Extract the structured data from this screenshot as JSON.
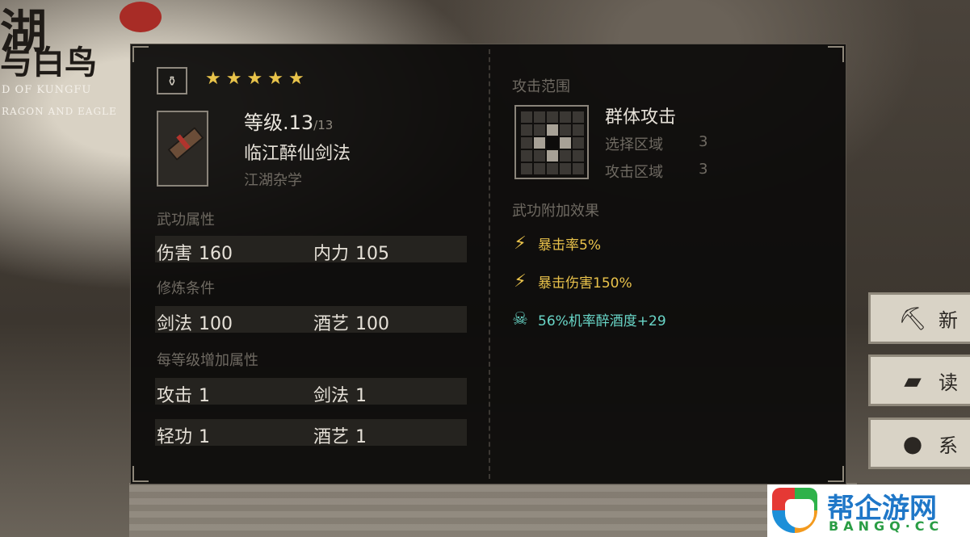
{
  "logo": {
    "title_big": "湖",
    "title_sub": "与白鸟",
    "subtitle_en_1": "D OF KUNGFU",
    "subtitle_en_2": "RAGON AND EAGLE"
  },
  "skill": {
    "rarity_stars": 5,
    "level_label": "等级.13",
    "level_max": "/13",
    "name": "临江醉仙剑法",
    "category": "江湖杂学"
  },
  "sections": {
    "attributes_title": "武功属性",
    "requirements_title": "修炼条件",
    "per_level_title": "每等级增加属性"
  },
  "attributes": [
    {
      "label": "伤害",
      "value": "160"
    },
    {
      "label": "内力",
      "value": "105"
    }
  ],
  "requirements": [
    {
      "label": "剑法",
      "value": "100"
    },
    {
      "label": "酒艺",
      "value": "100"
    }
  ],
  "per_level": [
    {
      "label": "攻击",
      "value": "1"
    },
    {
      "label": "剑法",
      "value": "1"
    },
    {
      "label": "轻功",
      "value": "1"
    },
    {
      "label": "酒艺",
      "value": "1"
    }
  ],
  "attack_range": {
    "title": "攻击范围",
    "type": "群体攻击",
    "select_label": "选择区域",
    "select_value": "3",
    "attack_label": "攻击区域",
    "attack_value": "3"
  },
  "effects_title": "武功附加效果",
  "effects": [
    {
      "icon": "lightning-circle-icon",
      "text": "暴击率5%",
      "color": "#e9c24b"
    },
    {
      "icon": "lightning-icon",
      "text": "暴击伤害150%",
      "color": "#e9c24b"
    },
    {
      "icon": "skull-icon",
      "text": "56%机率醉酒度+29",
      "color": "#69d6c8"
    }
  ],
  "side_menu": [
    {
      "icon": "pickaxe-icon",
      "label": "新"
    },
    {
      "icon": "book-icon",
      "label": "读"
    },
    {
      "icon": "pouch-icon",
      "label": "系"
    }
  ],
  "watermark": {
    "cn": "帮企游网",
    "en": "BANGQ·CC"
  }
}
